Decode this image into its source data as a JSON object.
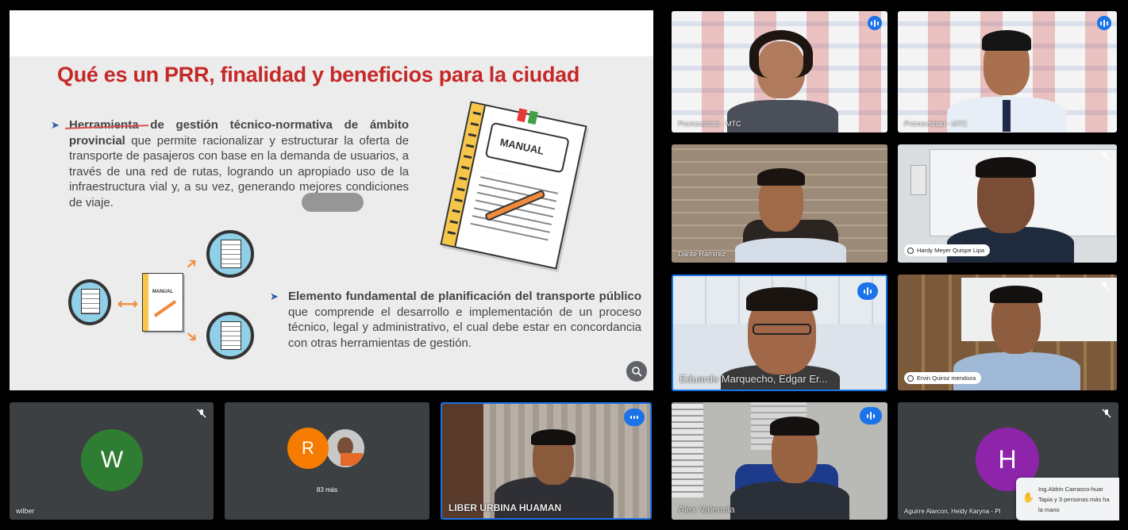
{
  "slide": {
    "title": "Qué es un PRR, finalidad y beneficios para la ciudad",
    "bullet1_bold": "Herramienta de gestión técnico-normativa de ámbito provincial",
    "bullet1_rest": " que permite racionalizar y estructurar la oferta de transporte de pasajeros con base en la demanda de usuarios, a través de una red de rutas, logrando un apropiado uso de la infraestructura vial y, a su vez, generando mejores condiciones de viaje.",
    "bullet2_bold": "Elemento fundamental de planificación del transporte público",
    "bullet2_rest": " que comprende el desarrollo e implementación de un proceso técnico, legal y administrativo, el cual debe estar en concordancia con otras herramientas de gestión.",
    "manual_label": "MANUAL",
    "manual_small_label": "MANUAL",
    "zoom_icon": "zoom-in-icon"
  },
  "tiles": {
    "t1": {
      "name": "Promovilidad - MTC"
    },
    "t2": {
      "name": "Promovilidad - MTC"
    },
    "t3": {
      "name": "Dante Ramirez"
    },
    "t4": {
      "name": "Hardy Meyer Quispe Lipa"
    },
    "t5": {
      "name": "Eduardo Marquecho, Edgar Er..."
    },
    "t6": {
      "name": "Ervin Quiroz mendoza"
    },
    "t7": {
      "name": "wilber",
      "initial": "W",
      "color": "#2e7d32"
    },
    "t8": {
      "initial": "R",
      "color": "#f57c00",
      "more": "83 más"
    },
    "t9": {
      "name": "LIBER URBINA HUAMAN"
    },
    "t10": {
      "name": "Alex Valencia"
    },
    "t11": {
      "name": "Aguirre Alarcon, Heidy Karyna - Pl",
      "initial": "H",
      "color": "#8e24aa"
    }
  },
  "notification": {
    "line1": "Ing.Aldrin Carrasco-huar",
    "line2": "Tapia y 3 personas más ha",
    "line3": "la mano"
  },
  "colors": {
    "accent": "#1a73e8",
    "title_red": "#c62828",
    "arrow_orange": "#f08a3c"
  }
}
